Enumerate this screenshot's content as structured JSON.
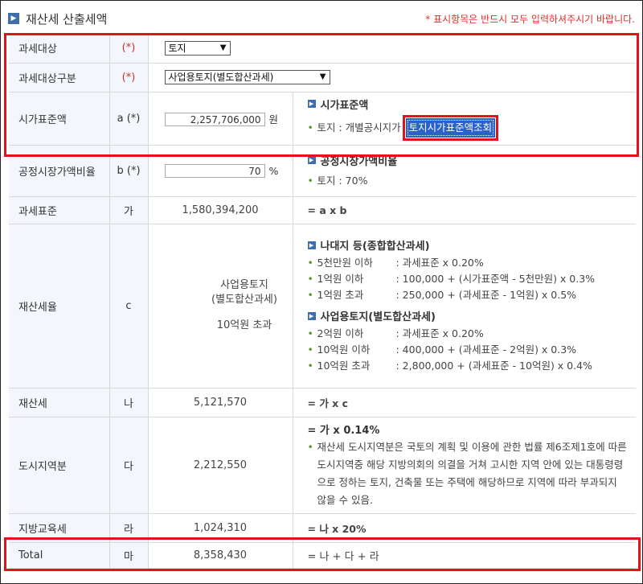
{
  "header": {
    "icon": "chevron-right-icon",
    "title": "재산세 산출세액",
    "note": "* 표시항목은 반드시 모두 입력하셔주시기 바랍니다."
  },
  "rows": {
    "taxobj": {
      "label": "과세대상",
      "symbol": "(*)",
      "select": "토지"
    },
    "taxcls": {
      "label": "과세대상구분",
      "symbol": "(*)",
      "select": "사업용토지(별도합산과세)"
    },
    "stdprice": {
      "label": "시가표준액",
      "symbol": "a (*)",
      "value": "2,257,706,000",
      "unit": "원",
      "desc_title": "시가표준액",
      "desc_item": "토지 : 개별공시지가",
      "lookup_button": "토지시가표준액조회"
    },
    "ratio": {
      "label": "공정시장가액비율",
      "symbol": "b (*)",
      "value": "70",
      "unit": "%",
      "desc_title": "공정시장가액비율",
      "desc_item": "토지 : 70%"
    },
    "taxbase": {
      "label": "과세표준",
      "symbol": "가",
      "value": "1,580,394,200",
      "formula": "= a x b"
    },
    "taxrate": {
      "label": "재산세율",
      "symbol": "c",
      "val1": "사업용토지",
      "val2": "(별도합산과세)",
      "val3": "10억원 초과",
      "g1_title": "나대지 등(종합합산과세)",
      "g1_items": [
        {
          "k": "5천만원 이하",
          "v": ": 과세표준 x 0.20%"
        },
        {
          "k": "1억원 이하",
          "v": ": 100,000 + (시가표준액 - 5천만원) x 0.3%"
        },
        {
          "k": "1억원 초과",
          "v": ": 250,000 + (과세표준 - 1억원) x 0.5%"
        }
      ],
      "g2_title": "사업용토지(별도합산과세)",
      "g2_items": [
        {
          "k": "2억원 이하",
          "v": ": 과세표준 x 0.20%"
        },
        {
          "k": "10억원 이하",
          "v": ": 400,000 + (과세표준 - 2억원) x 0.3%"
        },
        {
          "k": "10억원 초과",
          "v": ": 2,800,000 + (과세표준 - 10억원) x 0.4%"
        }
      ]
    },
    "proptax": {
      "label": "재산세",
      "symbol": "나",
      "value": "5,121,570",
      "formula": "= 가 x c"
    },
    "citytax": {
      "label": "도시지역분",
      "symbol": "다",
      "value": "2,212,550",
      "formula": "= 가 x 0.14%",
      "note": "재산세 도시지역분은 국토의 계획 및 이용에 관한 법률 제6조제1호에 따른 도시지역중 해당 지방의회의 의결을 거쳐 고시한 지역 안에 있는 대통령령으로 정하는 토지, 건축물 또는 주택에 해당하므로 지역에 따라 부과되지 않을 수 있음."
    },
    "edutax": {
      "label": "지방교육세",
      "symbol": "라",
      "value": "1,024,310",
      "formula": "= 나 x 20%"
    },
    "total": {
      "label": "Total",
      "symbol": "마",
      "value": "8,358,430",
      "formula": "= 나 + 다 + 라"
    }
  },
  "colors": {
    "accent": "#3d6ea8",
    "required": "#d0302a",
    "highlight": "#e0141a",
    "button": "#2a62c9"
  }
}
